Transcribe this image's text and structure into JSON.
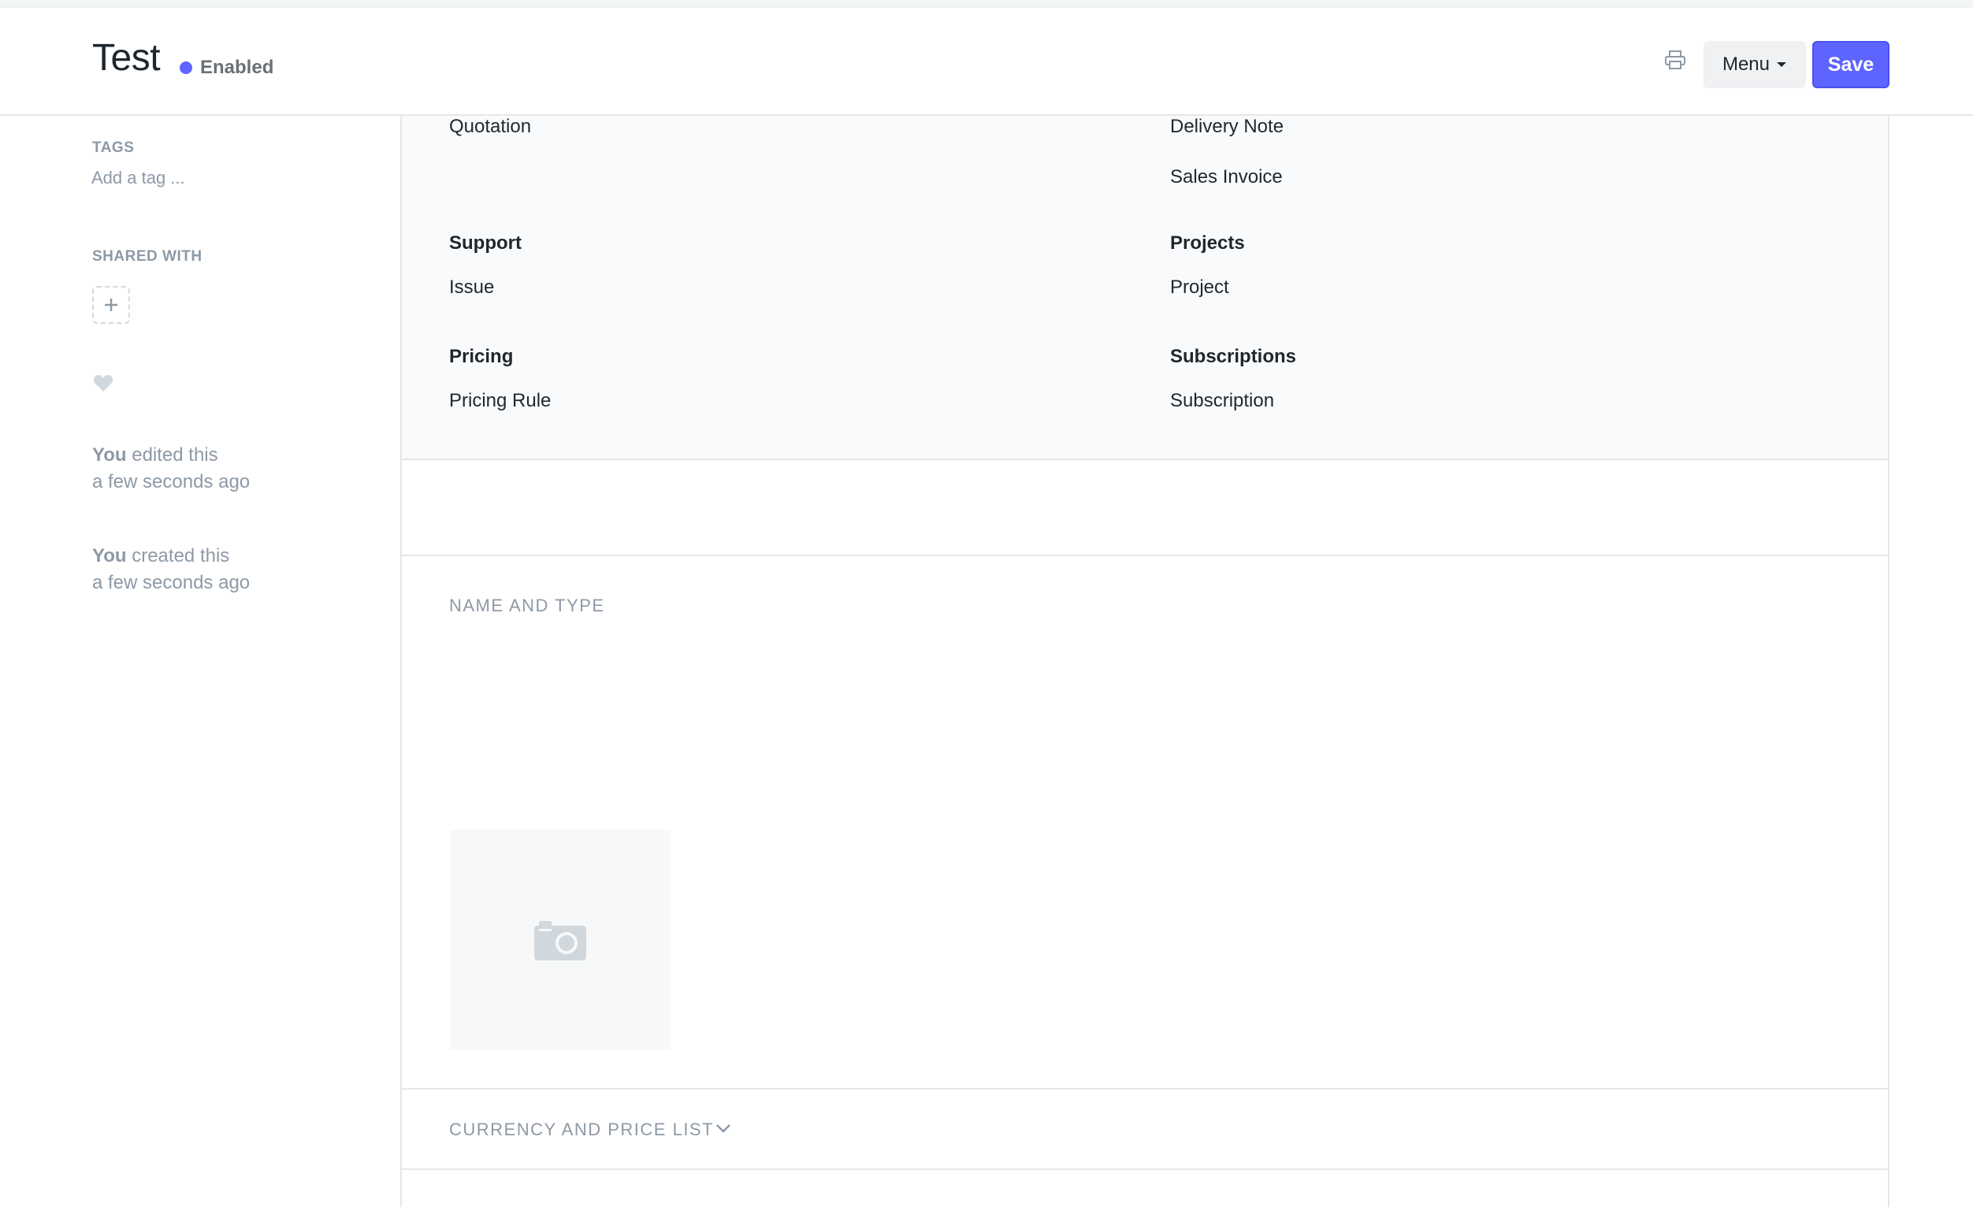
{
  "header": {
    "title": "Test",
    "status": "Enabled",
    "menu_label": "Menu",
    "save_label": "Save",
    "print_icon": "print-icon",
    "status_color": "#5e64ff",
    "accent_color": "#5e64ff"
  },
  "sidebar": {
    "tags_label": "TAGS",
    "add_tag_placeholder": "Add a tag ...",
    "shared_with_label": "SHARED WITH",
    "timeline": [
      {
        "user": "You",
        "action": "edited this",
        "time": "a few seconds ago"
      },
      {
        "user": "You",
        "action": "created this",
        "time": "a few seconds ago"
      }
    ]
  },
  "connections": {
    "left": [
      {
        "heading": "",
        "links": [
          "Quotation"
        ]
      },
      {
        "heading": "Support",
        "links": [
          "Issue"
        ]
      },
      {
        "heading": "Pricing",
        "links": [
          "Pricing Rule"
        ]
      }
    ],
    "right": [
      {
        "heading": "",
        "links": [
          "Delivery Note",
          "Sales Invoice"
        ]
      },
      {
        "heading": "Projects",
        "links": [
          "Project"
        ]
      },
      {
        "heading": "Subscriptions",
        "links": [
          "Subscription"
        ]
      }
    ]
  },
  "sections": {
    "name_and_type": "NAME AND TYPE",
    "currency_and_price_list": "CURRENCY AND PRICE LIST"
  }
}
